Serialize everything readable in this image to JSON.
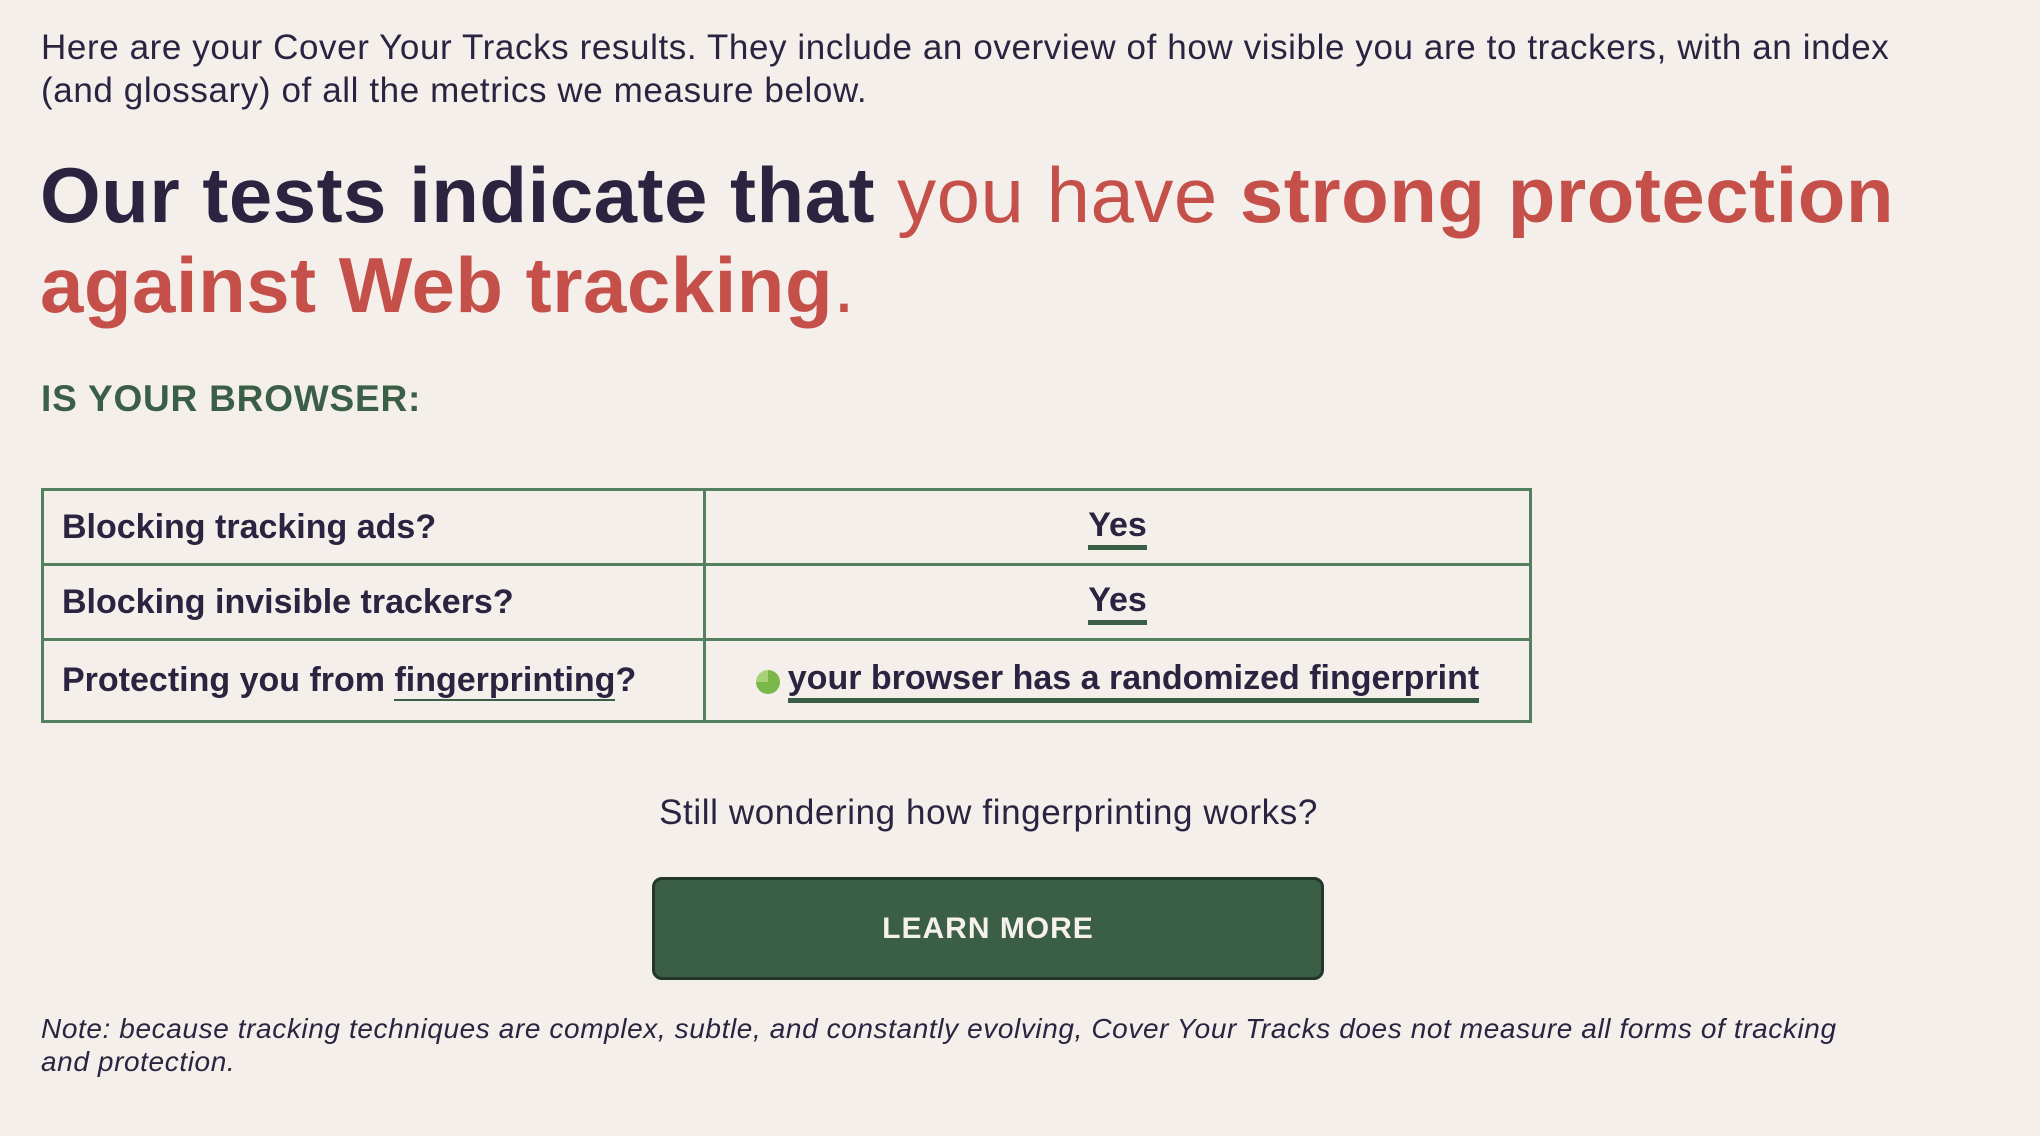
{
  "intro": "Here are your Cover Your Tracks results. They include an overview of how visible you are to trackers, with an index (and glossary) of all the metrics we measure below.",
  "headline": {
    "lead": "Our tests indicate that ",
    "light": "you have ",
    "strong": "strong protection against Web tracking",
    "end": "."
  },
  "section_label": "IS YOUR BROWSER:",
  "results": {
    "rows": [
      {
        "question": "Blocking tracking ads?",
        "answer": "Yes"
      },
      {
        "question": "Blocking invisible trackers?",
        "answer": "Yes"
      },
      {
        "question_prefix": "Protecting you from ",
        "question_link": "fingerprinting",
        "question_suffix": "?",
        "answer": "your browser has a randomized fingerprint",
        "answer_icon": "partial-circle-icon"
      }
    ]
  },
  "wonder": "Still wondering how fingerprinting works?",
  "learn_more_label": "LEARN MORE",
  "note": "Note: because tracking techniques are complex, subtle, and constantly evolving, Cover Your Tracks does not measure all forms of tracking and protection.",
  "colors": {
    "background": "#f4efeb",
    "text": "#2a2440",
    "accent_red": "#c5504a",
    "accent_green": "#3b5e47",
    "icon_green": "#7ab648"
  }
}
